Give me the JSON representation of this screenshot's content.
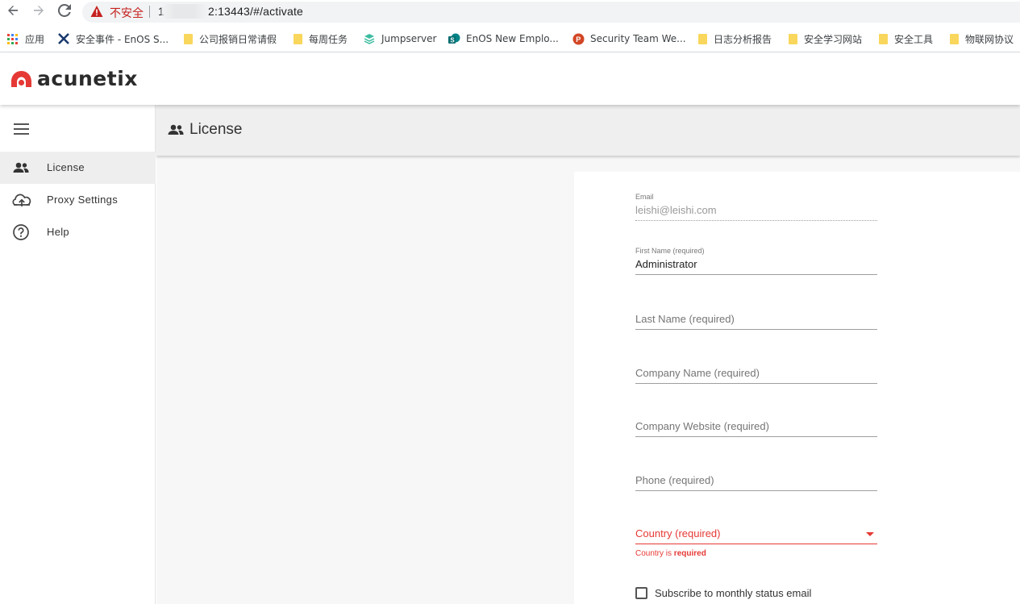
{
  "browser": {
    "security_label": "不安全",
    "url_visible": "1",
    "url_tail": "2:13443/#/activate",
    "bookmarks": [
      {
        "label": "应用",
        "icon": "apps-grid-icon"
      },
      {
        "label": "安全事件 - EnOS S...",
        "icon": "enos-x-icon"
      },
      {
        "label": "公司报销日常请假",
        "icon": "folder-icon"
      },
      {
        "label": "每周任务",
        "icon": "folder-icon"
      },
      {
        "label": "Jumpserver",
        "icon": "jumpserver-icon"
      },
      {
        "label": "EnOS New Emplo...",
        "icon": "sharepoint-icon"
      },
      {
        "label": "Security Team We...",
        "icon": "powerpoint-icon"
      },
      {
        "label": "日志分析报告",
        "icon": "folder-icon"
      },
      {
        "label": "安全学习网站",
        "icon": "folder-icon"
      },
      {
        "label": "安全工具",
        "icon": "folder-icon"
      },
      {
        "label": "物联网协议",
        "icon": "folder-icon"
      }
    ]
  },
  "app": {
    "logo_text": "acunetix",
    "brand_color": "#e53935"
  },
  "sidebar": {
    "items": [
      {
        "label": "License",
        "icon": "users-icon",
        "active": true
      },
      {
        "label": "Proxy Settings",
        "icon": "cloud-upload-icon",
        "active": false
      },
      {
        "label": "Help",
        "icon": "help-circle-icon",
        "active": false
      }
    ]
  },
  "page": {
    "title": "License"
  },
  "form": {
    "email": {
      "label": "Email",
      "value": "leishi@leishi.com"
    },
    "first_name": {
      "label": "First Name (required)",
      "value": "Administrator"
    },
    "last_name": {
      "placeholder": "Last Name (required)"
    },
    "company_name": {
      "placeholder": "Company Name (required)"
    },
    "company_website": {
      "placeholder": "Company Website (required)"
    },
    "phone": {
      "placeholder": "Phone (required)"
    },
    "country": {
      "placeholder": "Country (required)",
      "error_prefix": "Country is ",
      "error_strong": "required"
    },
    "subscribe_label": "Subscribe to monthly status email"
  }
}
